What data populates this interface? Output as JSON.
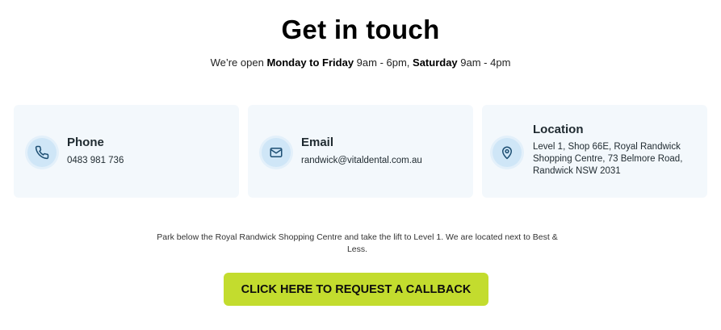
{
  "header": {
    "title": "Get in touch",
    "hours_prefix": "We’re open ",
    "weekday_label": "Monday to Friday",
    "weekday_hours": " 9am - 6pm, ",
    "saturday_label": "Saturday",
    "saturday_hours": " 9am - 4pm"
  },
  "cards": [
    {
      "title": "Phone",
      "value": "0483 981 736",
      "icon": "phone-icon"
    },
    {
      "title": "Email",
      "value": "randwick@vitaldental.com.au",
      "icon": "mail-icon"
    },
    {
      "title": "Location",
      "value": "Level 1, Shop 66E, Royal Randwick Shopping Centre, 73 Belmore Road, Randwick NSW 2031",
      "icon": "location-pin-icon"
    }
  ],
  "note": "Park below the Royal Randwick Shopping Centre and take the lift to Level 1. We are located next to Best & Less.",
  "cta": {
    "label": "CLICK HERE TO REQUEST A CALLBACK"
  },
  "colors": {
    "accent": "#c3dc2e",
    "card_bg": "#f3f8fc",
    "icon_bg": "#cfe6f7",
    "icon_stroke": "#1d4f73"
  }
}
